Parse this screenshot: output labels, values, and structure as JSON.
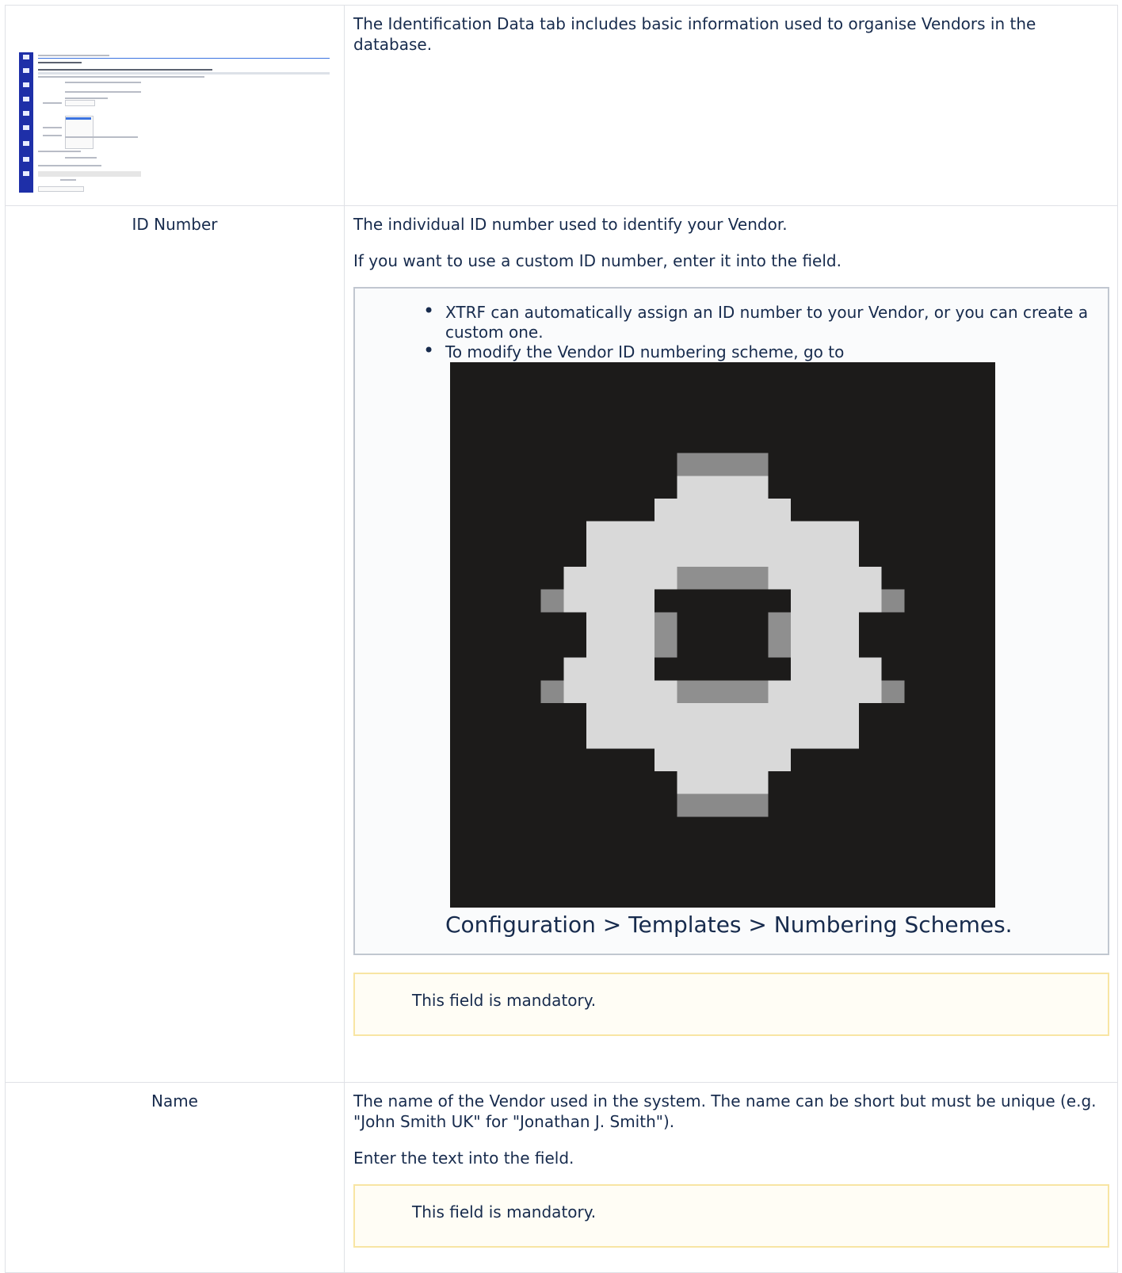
{
  "rows": [
    {
      "label": "",
      "description": "The Identification Data tab includes basic information used to organise Vendors in the database."
    },
    {
      "label": "ID Number",
      "paragraphs": [
        "The individual ID number used to identify your Vendor.",
        "If you want to use a custom ID number, enter it into the field."
      ],
      "info_items": [
        "XTRF can automatically assign an ID number to your Vendor, or you can create a custom one.",
        "To modify the Vendor ID numbering scheme, go to"
      ],
      "info_path": "Configuration > Templates > Numbering Schemes.",
      "note": "This field is mandatory."
    },
    {
      "label": "Name",
      "paragraphs": [
        "The name of the Vendor used in the system. The name can be short but must be unique (e.g. \"John Smith UK\" for \"Jonathan J. Smith\").",
        "Enter the text into the field."
      ],
      "note": "This field is mandatory."
    }
  ],
  "icons": {
    "gear": "gear-icon",
    "bullet": "bullet-icon"
  },
  "colors": {
    "table_border": "#dfe1e6",
    "info_border": "#c1c7d0",
    "info_bg": "#fafbfc",
    "note_border": "#f8e5a3",
    "note_bg": "#fffdf5",
    "gear_bg": "#1c1b1a",
    "gear_fg": "#d9d9d9",
    "thumbnail_sidebar": "#1e2fa8"
  }
}
